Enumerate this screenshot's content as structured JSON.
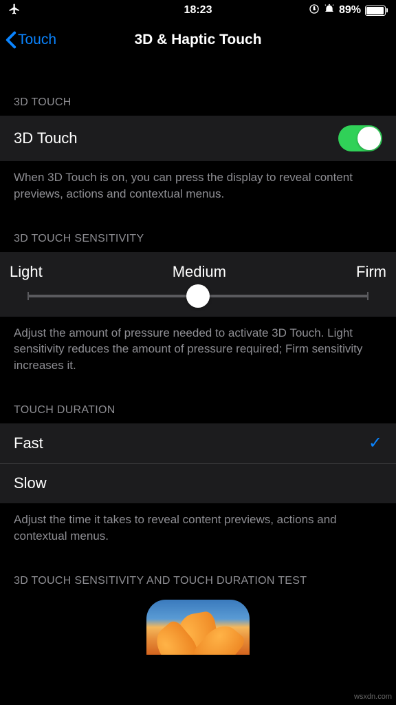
{
  "status": {
    "time": "18:23",
    "battery_pct": "89%"
  },
  "nav": {
    "back_label": "Touch",
    "title": "3D & Haptic Touch"
  },
  "section_3dtouch": {
    "header": "3D Touch",
    "row_label": "3D Touch",
    "toggle_on": true,
    "footer": "When 3D Touch is on, you can press the display to reveal content previews, actions and contextual menus."
  },
  "section_sensitivity": {
    "header": "3D Touch Sensitivity",
    "labels": {
      "light": "Light",
      "medium": "Medium",
      "firm": "Firm"
    },
    "value": "Medium",
    "footer": "Adjust the amount of pressure needed to activate 3D Touch. Light sensitivity reduces the amount of pressure required; Firm sensitivity increases it."
  },
  "section_duration": {
    "header": "Touch Duration",
    "option_fast": "Fast",
    "option_slow": "Slow",
    "selected": "Fast",
    "footer": "Adjust the time it takes to reveal content previews, actions and contextual menus."
  },
  "section_test": {
    "header": "3D Touch Sensitivity and Touch Duration Test"
  },
  "watermark": "wsxdn.com"
}
